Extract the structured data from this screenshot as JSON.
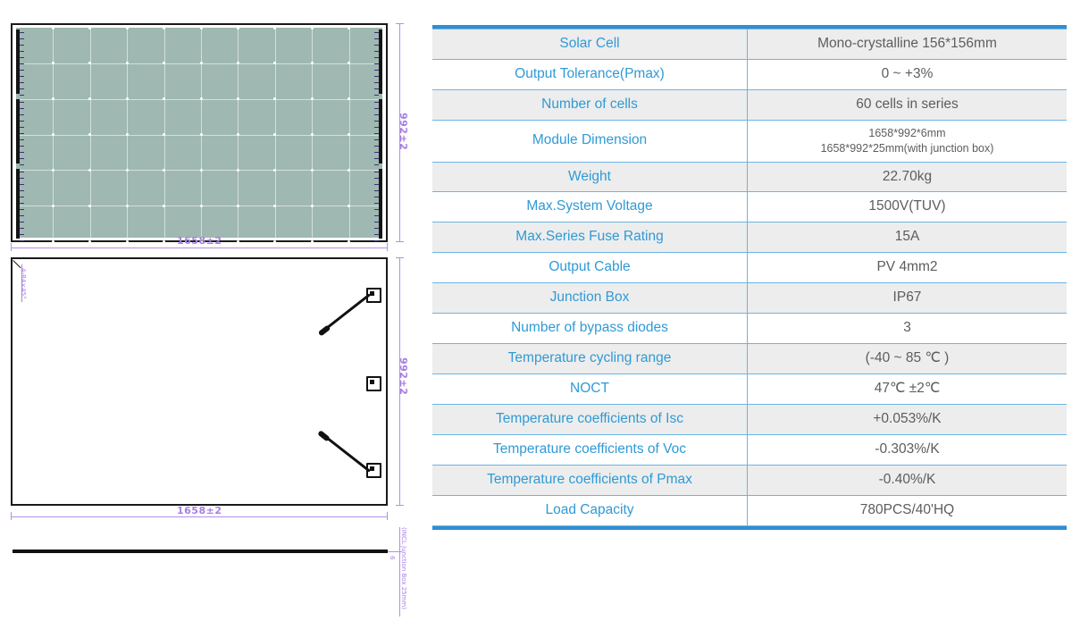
{
  "drawing": {
    "front_view": {
      "name": "solar-module-front-view",
      "width_label": "1658±2",
      "height_label": "992±2",
      "cell_columns": 10,
      "cell_rows": 6,
      "glass_color": "#9fb8b2",
      "frame_color": "#1a1a1a"
    },
    "back_view": {
      "name": "solar-module-back-view",
      "width_label": "1658±2",
      "height_label": "992±2",
      "chamfer_label": "4-R4×45°",
      "junction_boxes": 3,
      "cables": 2
    },
    "side_view": {
      "name": "solar-module-side-view",
      "thickness_label": "6",
      "junction_box_note": "(INCL Junction Box 25mm)"
    },
    "dimension_color": "#a67fe0"
  },
  "spec_table": {
    "accent_color": "#2f9ad6",
    "rule_color": "#2f8fd0",
    "row_stripe_color": "#ededed",
    "value_color": "#5d5d5d",
    "rows": [
      {
        "key": "Solar Cell",
        "value": "Mono-crystalline 156*156mm"
      },
      {
        "key": "Output Tolerance(Pmax)",
        "value": "0 ~ +3%"
      },
      {
        "key": "Number of cells",
        "value": "60 cells in series"
      },
      {
        "key": "Module Dimension",
        "value": "1658*992*6mm",
        "value2": "1658*992*25mm(with junction box)",
        "small": true
      },
      {
        "key": "Weight",
        "value": "22.70kg"
      },
      {
        "key": "Max.System Voltage",
        "value": "1500V(TUV)"
      },
      {
        "key": "Max.Series Fuse Rating",
        "value": "15A"
      },
      {
        "key": "Output Cable",
        "value": "PV 4mm2"
      },
      {
        "key": "Junction Box",
        "value": "IP67"
      },
      {
        "key": "Number of bypass diodes",
        "value": "3"
      },
      {
        "key": "Temperature cycling range",
        "value": "(-40 ~ 85 ℃ )"
      },
      {
        "key": "NOCT",
        "value": "47℃ ±2℃"
      },
      {
        "key": "Temperature coefficients of Isc",
        "value": "+0.053%/K"
      },
      {
        "key": "Temperature coefficients of Voc",
        "value": "-0.303%/K"
      },
      {
        "key": "Temperature coefficients of Pmax",
        "value": "-0.40%/K"
      },
      {
        "key": "Load Capacity",
        "value": "780PCS/40'HQ"
      }
    ]
  }
}
